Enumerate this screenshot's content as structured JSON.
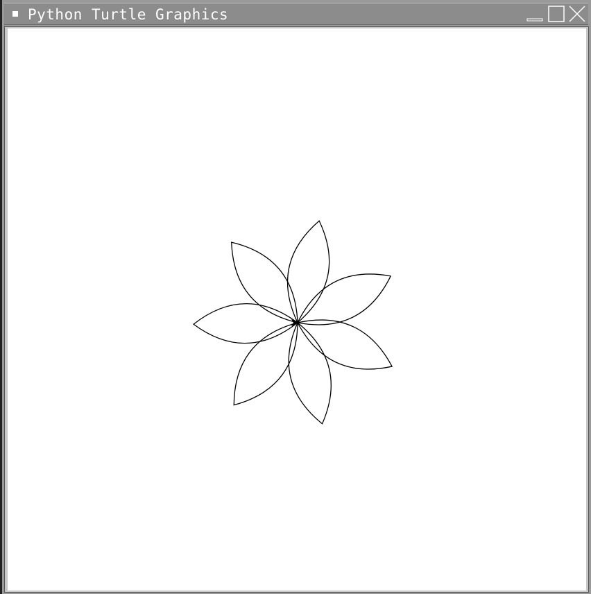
{
  "window": {
    "title": "Python Turtle Graphics"
  },
  "controls": {
    "minimize_icon": "minimize-icon",
    "maximize_icon": "maximize-icon",
    "close_icon": "close-icon"
  },
  "canvas": {
    "background": "#ffffff",
    "drawing": {
      "shape": "flower",
      "petal_count": 7,
      "stroke_color": "#000000"
    }
  }
}
